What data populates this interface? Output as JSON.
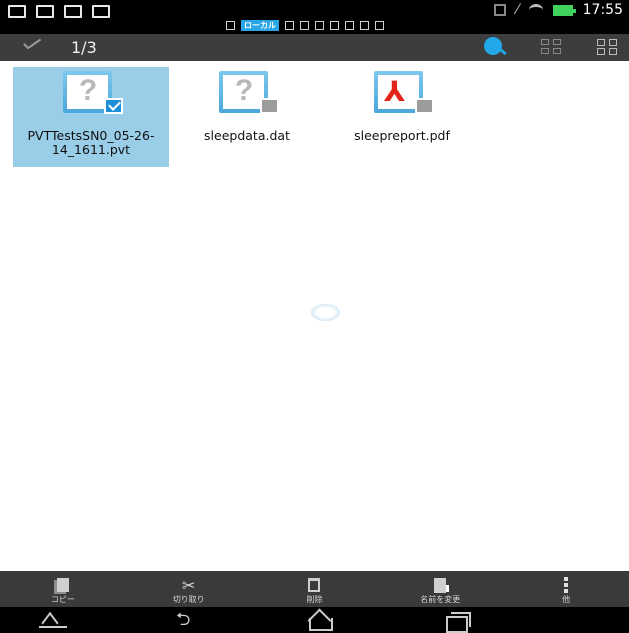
{
  "status_bar": {
    "time": "17:55",
    "center_tag": "ローカル",
    "left_icons": [
      "image-icon",
      "mail-icon",
      "document-icon",
      "checkbox-icon"
    ],
    "right_icons": [
      "battery-icon",
      "wifi-icon",
      "no-signal-icon",
      "vibrate-icon"
    ]
  },
  "action_bar": {
    "selection_count": "1/3",
    "icons": [
      "confirm-selection-icon",
      "network-search-icon",
      "grid-view-icon",
      "select-all-icon"
    ],
    "accent_color": "#21a8e8"
  },
  "files": [
    {
      "name": "PVTTestsSN0_05-26-14_1611.pvt",
      "icon": "unknown-file-icon",
      "selected": true
    },
    {
      "name": "sleepdata.dat",
      "icon": "unknown-file-icon",
      "selected": false
    },
    {
      "name": "sleepreport.pdf",
      "icon": "pdf-file-icon",
      "selected": false
    }
  ],
  "toolbar": {
    "copy_label": "コピー",
    "cut_label": "切り取り",
    "delete_label": "削除",
    "rename_label": "名前を変更",
    "more_label": "他"
  },
  "nav_bar": {
    "icons": [
      "collapse-up-icon",
      "back-icon",
      "home-icon",
      "recent-apps-icon"
    ]
  }
}
